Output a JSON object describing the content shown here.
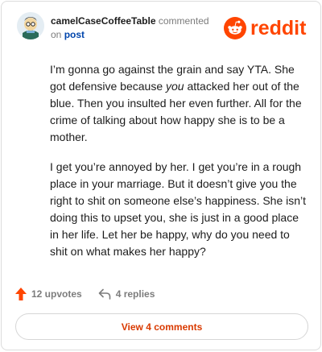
{
  "comment": {
    "username": "camelCaseCoffeeTable",
    "action_text": "commented",
    "on_text": "on",
    "link_text": "post"
  },
  "brand": {
    "logo_text": "reddit",
    "color": "#ff4500"
  },
  "body": {
    "paragraph1_before": "I’m gonna go against the grain and say YTA. She got defensive because ",
    "paragraph1_emphasis": "you",
    "paragraph1_after": " attacked her out of the blue. Then you insulted her even further. All for the crime of talking about how happy she is to be a mother.",
    "paragraph2": "I get you’re annoyed by her. I get you’re in a rough place in your marriage. But it doesn’t give you the right to shit on someone else’s happiness. She isn’t doing this to upset you, she is just in a good place in her life. Let her be happy, why do you need to shit on what makes her happy?"
  },
  "actions": {
    "upvotes_label": "12 upvotes",
    "replies_label": "4 replies",
    "upvote_icon": "upvote-arrow-icon",
    "reply_icon": "reply-arrow-icon"
  },
  "footer": {
    "view_comments_label": "View 4 comments"
  }
}
